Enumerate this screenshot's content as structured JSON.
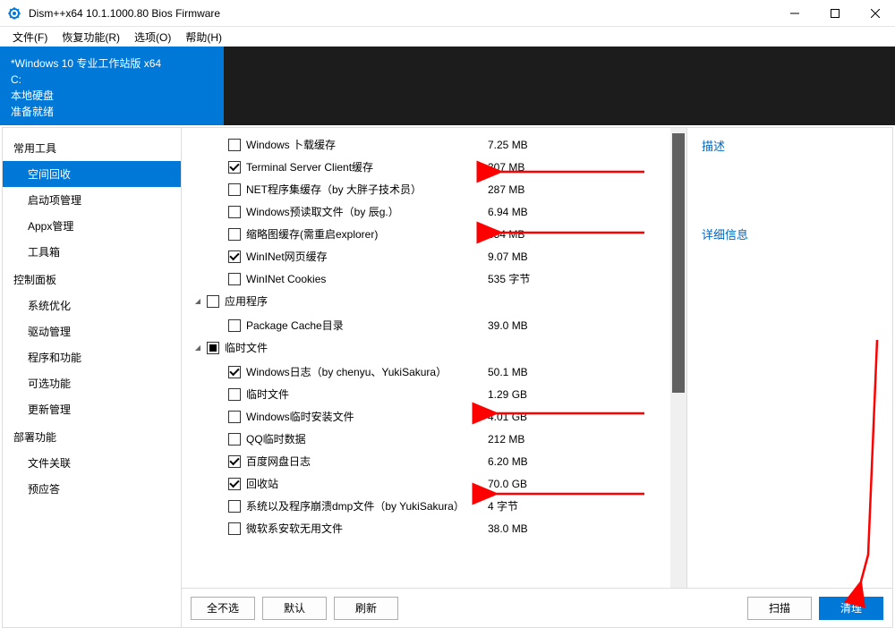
{
  "window": {
    "title": "Dism++x64 10.1.1000.80 Bios Firmware"
  },
  "menu": {
    "file": "文件(F)",
    "restore": "恢复功能(R)",
    "options": "选项(O)",
    "help": "帮助(H)"
  },
  "info": {
    "os": "*Windows 10 专业工作站版 x64",
    "drive": "C:",
    "disk": "本地硬盘",
    "status": "准备就绪"
  },
  "sidebar": {
    "g1": "常用工具",
    "i1": "空间回收",
    "i2": "启动项管理",
    "i3": "Appx管理",
    "i4": "工具箱",
    "g2": "控制面板",
    "i5": "系统优化",
    "i6": "驱动管理",
    "i7": "程序和功能",
    "i8": "可选功能",
    "i9": "更新管理",
    "g3": "部署功能",
    "i10": "文件关联",
    "i11": "预应答"
  },
  "rows": [
    {
      "type": "child",
      "chk": "",
      "name": "Windows 卜载缓存",
      "size": "7.25 MB"
    },
    {
      "type": "child",
      "chk": "checked",
      "name": "Terminal Server Client缓存",
      "size": "307 MB"
    },
    {
      "type": "child",
      "chk": "",
      "name": "NET程序集缓存（by 大胖子技术员）",
      "size": "287 MB"
    },
    {
      "type": "child",
      "chk": "",
      "name": "Windows预读取文件（by 辰g.）",
      "size": "6.94 MB"
    },
    {
      "type": "child",
      "chk": "",
      "name": "缩略图缓存(需重启explorer)",
      "size": "654 MB"
    },
    {
      "type": "child",
      "chk": "checked",
      "name": "WinINet网页缓存",
      "size": "9.07 MB"
    },
    {
      "type": "child",
      "chk": "",
      "name": "WinINet Cookies",
      "size": "535 字节"
    },
    {
      "type": "group",
      "chk": "",
      "name": "应用程序",
      "size": ""
    },
    {
      "type": "child",
      "chk": "",
      "name": "Package Cache目录",
      "size": "39.0 MB"
    },
    {
      "type": "group",
      "chk": "indet",
      "name": "临时文件",
      "size": ""
    },
    {
      "type": "child",
      "chk": "checked",
      "name": "Windows日志（by chenyu、YukiSakura）",
      "size": "50.1 MB"
    },
    {
      "type": "child",
      "chk": "",
      "name": "临时文件",
      "size": "1.29 GB"
    },
    {
      "type": "child",
      "chk": "",
      "name": "Windows临时安装文件",
      "size": "4.01 GB"
    },
    {
      "type": "child",
      "chk": "",
      "name": "QQ临时数据",
      "size": "212 MB"
    },
    {
      "type": "child",
      "chk": "checked",
      "name": "百度网盘日志",
      "size": "6.20 MB"
    },
    {
      "type": "child",
      "chk": "checked",
      "name": "回收站",
      "size": "70.0 GB"
    },
    {
      "type": "child",
      "chk": "",
      "name": "系统以及程序崩溃dmp文件（by YukiSakura）",
      "size": "4 字节"
    },
    {
      "type": "child",
      "chk": "",
      "name": "微软系安软无用文件",
      "size": "38.0 MB"
    }
  ],
  "rightpanel": {
    "desc": "描述",
    "detail": "详细信息"
  },
  "footer": {
    "deselect": "全不选",
    "default": "默认",
    "refresh": "刷新",
    "scan": "扫描",
    "clean": "清理"
  }
}
